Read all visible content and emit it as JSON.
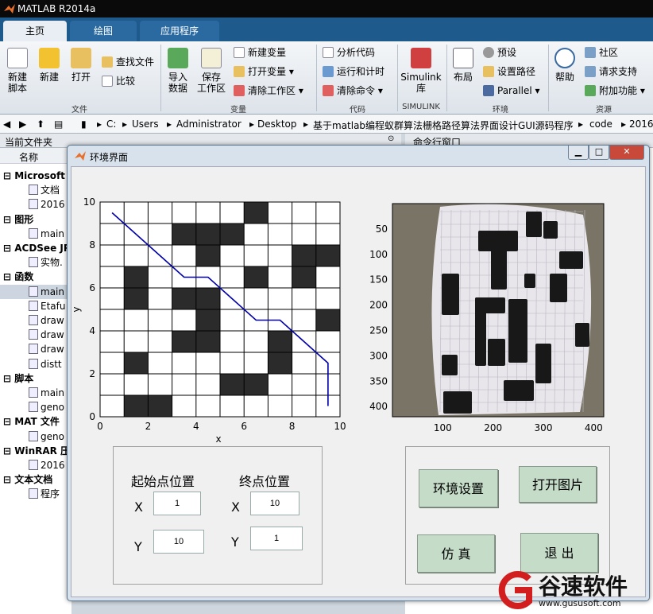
{
  "app": {
    "title": "MATLAB R2014a"
  },
  "tabs": [
    {
      "label": "主页"
    },
    {
      "label": "绘图"
    },
    {
      "label": "应用程序"
    }
  ],
  "ribbon": {
    "new_script": "新建\n脚本",
    "new": "新建",
    "open": "打开",
    "find_files": "查找文件",
    "compare": "比较",
    "import": "导入\n数据",
    "save_ws": "保存\n工作区",
    "new_var": "新建变量",
    "open_var": "打开变量",
    "clear_ws": "清除工作区",
    "analyze": "分析代码",
    "run_time": "运行和计时",
    "clear_cmd": "清除命令",
    "simulink": "Simulink\n库",
    "layout": "布局",
    "prefs": "预设",
    "set_path": "设置路径",
    "parallel": "Parallel",
    "help": "帮助",
    "community": "社区",
    "support": "请求支持",
    "addons": "附加功能",
    "groups": {
      "file": "文件",
      "variable": "变量",
      "code": "代码",
      "simulink": "SIMULINK",
      "env": "环境",
      "resources": "资源"
    }
  },
  "address": {
    "parts": [
      "C:",
      "Users",
      "Administrator",
      "Desktop",
      "基于matlab编程蚁群算法栅格路径算法界面设计GUI源码程序",
      "code",
      "2016"
    ]
  },
  "current_folder": {
    "title": "当前文件夹",
    "col_name": "名称",
    "rows": [
      {
        "text": "Microsoft",
        "head": true
      },
      {
        "text": "文档"
      },
      {
        "text": "2016"
      },
      {
        "text": "图形",
        "head": true
      },
      {
        "text": "main"
      },
      {
        "text": "ACDSee JP",
        "head": true
      },
      {
        "text": "实物."
      },
      {
        "text": "函数",
        "head": true
      },
      {
        "text": "main",
        "sel": true
      },
      {
        "text": "Etafu"
      },
      {
        "text": "draw"
      },
      {
        "text": "draw"
      },
      {
        "text": "draw"
      },
      {
        "text": "distt"
      },
      {
        "text": "脚本",
        "head": true
      },
      {
        "text": "main"
      },
      {
        "text": "geno"
      },
      {
        "text": "MAT 文件",
        "head": true
      },
      {
        "text": "geno"
      },
      {
        "text": "WinRAR 压",
        "head": true
      },
      {
        "text": "2016"
      },
      {
        "text": "文本文档",
        "head": true
      },
      {
        "text": "程序"
      }
    ]
  },
  "command_window": {
    "title": "命令行窗口"
  },
  "dialog": {
    "title": "环境界面",
    "start_label": "起始点位置",
    "end_label": "终点位置",
    "x_label": "X",
    "y_label": "Y",
    "start_x": "1",
    "start_y": "10",
    "end_x": "10",
    "end_y": "1",
    "btn_env": "环境设置",
    "btn_open": "打开图片",
    "btn_sim": "仿 真",
    "btn_exit": "退 出"
  },
  "chart_data": [
    {
      "type": "heatmap",
      "title": "",
      "xlabel": "x",
      "ylabel": "y",
      "xlim": [
        0,
        10
      ],
      "ylim": [
        0,
        10
      ],
      "xticks": [
        0,
        2,
        4,
        6,
        8,
        10
      ],
      "yticks": [
        0,
        2,
        4,
        6,
        8,
        10
      ],
      "obstacles": [
        [
          6,
          9
        ],
        [
          3,
          8
        ],
        [
          4,
          8
        ],
        [
          5,
          8
        ],
        [
          4,
          7
        ],
        [
          8,
          7
        ],
        [
          9,
          7
        ],
        [
          1,
          6
        ],
        [
          6,
          6
        ],
        [
          8,
          6
        ],
        [
          1,
          5
        ],
        [
          3,
          5
        ],
        [
          4,
          5
        ],
        [
          4,
          4
        ],
        [
          9,
          4
        ],
        [
          3,
          3
        ],
        [
          4,
          3
        ],
        [
          7,
          3
        ],
        [
          1,
          2
        ],
        [
          7,
          2
        ],
        [
          5,
          1
        ],
        [
          6,
          1
        ],
        [
          1,
          0
        ],
        [
          2,
          0
        ]
      ],
      "path": {
        "x": [
          0.5,
          1.5,
          2.5,
          3.5,
          4.5,
          5.5,
          6.5,
          7.5,
          8.5,
          9.5,
          9.5
        ],
        "y": [
          9.5,
          8.5,
          7.5,
          6.5,
          6.5,
          5.5,
          4.5,
          4.5,
          3.5,
          2.5,
          0.5
        ],
        "color": "#0000aa"
      },
      "grid": true
    },
    {
      "type": "image",
      "title": "",
      "xticks": [
        100,
        200,
        300,
        400
      ],
      "yticks": [
        50,
        100,
        150,
        200,
        250,
        300,
        350,
        400
      ],
      "xlim": [
        0,
        420
      ],
      "ylim": [
        0,
        420
      ]
    }
  ],
  "watermark": {
    "text": "谷速软件",
    "url": "www.gususoft.com"
  }
}
